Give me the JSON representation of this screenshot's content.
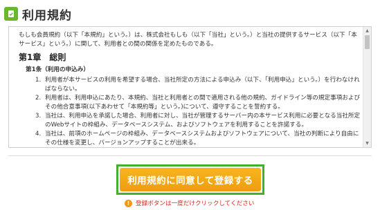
{
  "header": {
    "title": "利用規約",
    "icon": "document-check-icon",
    "icon_color": "#6ab72c"
  },
  "terms": {
    "intro": "もしも会員規約（以下「本規約」という。）は、株式会社もしも（以下「当社」という。）と当社の提供するサービス（以下「本サービス」という。）に関して、利用者との間の関係を定めたものである。",
    "chapter": "第1章　総則",
    "article": "第1条（利用の申込み）",
    "items": [
      {
        "num": "1.",
        "text": "利用者が本サービスの利用を希望する場合、当社所定の方法による申込み（以下、「利用申込」という。）を行わなければならない。"
      },
      {
        "num": "2.",
        "text": "利用者は、利用申込にあたり、本規約、当社と利用者との間で適用される他の規約、ガイドライン等の規定事項およびその他合意事項(以下あわせて「本規約等」という。)について、遵守することを誓約する。"
      },
      {
        "num": "3.",
        "text": "当社は、利用申込を承諾した場合、利用者に対し、当社が管理するサーバー内の本サービス利用に必要となる当社所定のWebサイトの枠組み、データベースシステム、およびソフトウェアを利用することを許諾する。"
      },
      {
        "num": "4.",
        "text": "当社は、前項のホームページの枠組み、データベースシステムおよびソフトウェアについて、当社の判断により自由にその仕様を変更し、バージョンアップすることが出来る。"
      }
    ]
  },
  "submit": {
    "label": "利用規約に同意して登録する",
    "bg_color": "#f4a91a",
    "outline_color": "#43b02a"
  },
  "notice": {
    "text": "登録ボタンは一度だけクリックしてください",
    "icon": "warning-icon",
    "color": "#d9241b"
  }
}
